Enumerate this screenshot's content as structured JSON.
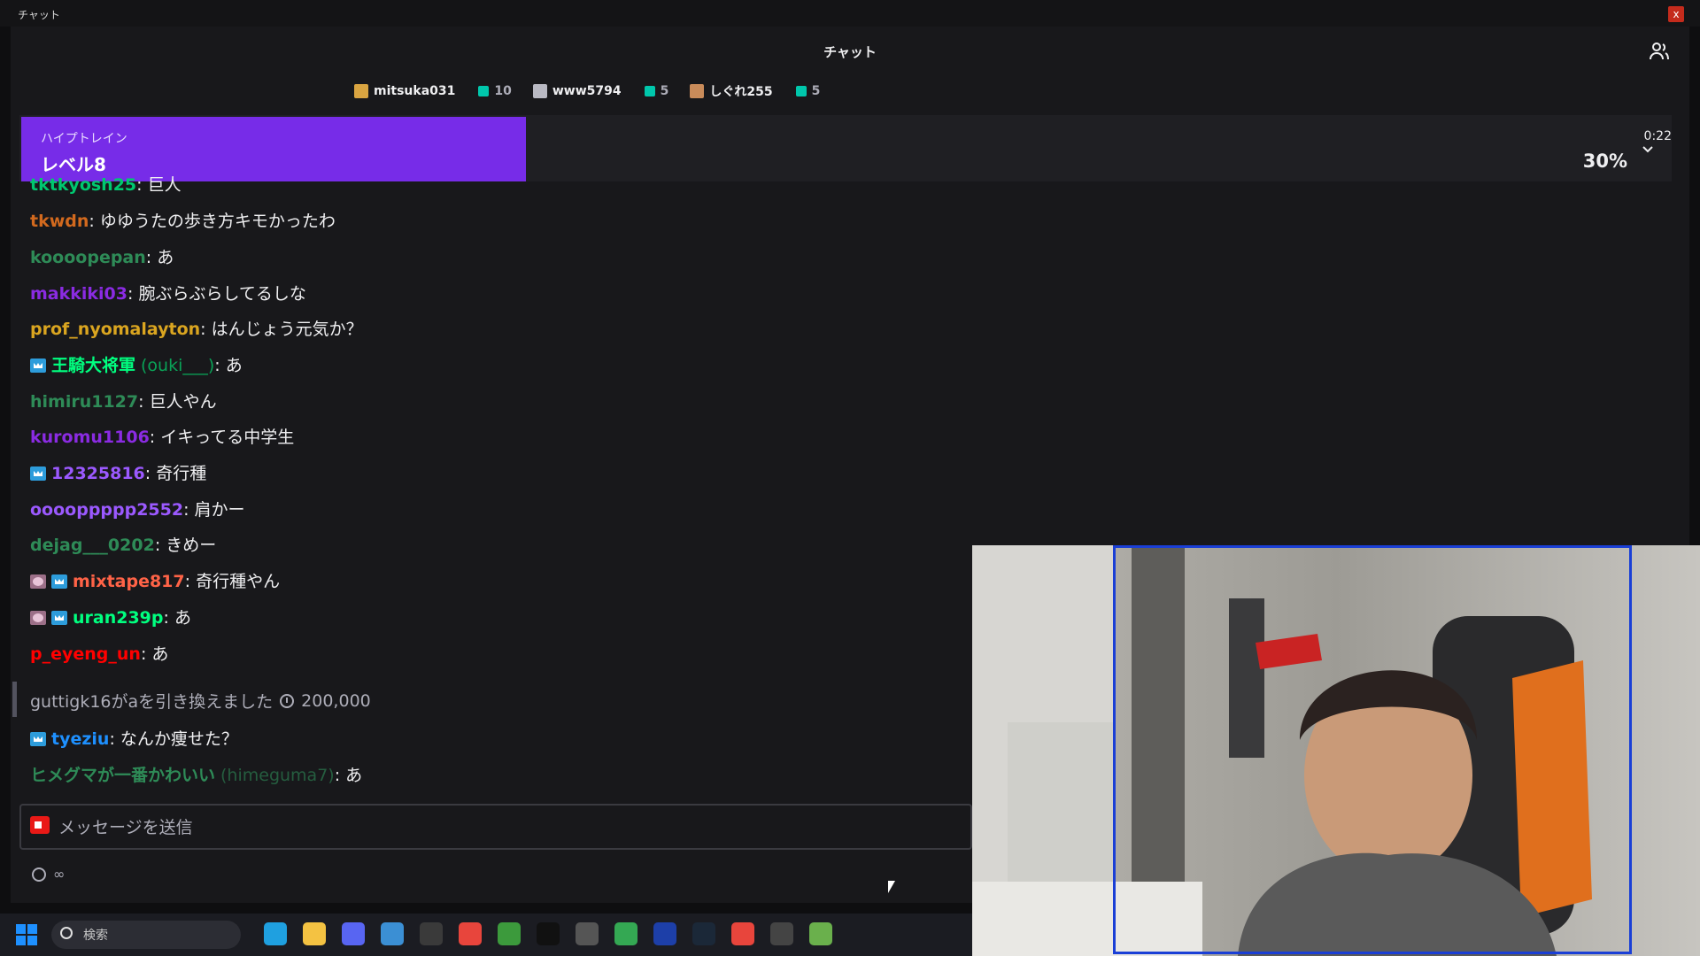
{
  "window": {
    "title": "チャット",
    "close_label": "x"
  },
  "header": {
    "title": "チャット"
  },
  "leaderboard": [
    {
      "name": "mitsuka031",
      "count": "10",
      "gift_color": "#d9a441"
    },
    {
      "name": "www5794",
      "count": "5",
      "gift_color": "#b9b9c3"
    },
    {
      "name": "しぐれ255",
      "count": "5",
      "gift_color": "#c98b5a"
    }
  ],
  "hype_train": {
    "label": "ハイプトレイン",
    "level": "レベル8",
    "time": "0:22",
    "percent": "30%",
    "progress_percent": 30
  },
  "messages": [
    {
      "user": "tktkyosh25",
      "text": ": 巨人",
      "color": "#00c870"
    },
    {
      "user": "tkwdn",
      "text": ": ゆゆうたの歩き方キモかったわ",
      "color": "#d2691e"
    },
    {
      "user": "koooopepan",
      "text": ": あ",
      "color": "#2e8b57"
    },
    {
      "user": "makkiki03",
      "text": ": 腕ぶらぶらしてるしな",
      "color": "#8a2be2"
    },
    {
      "user": "prof_nyomalayton",
      "text": ": はんじょう元気か？",
      "color": "#daa520"
    },
    {
      "user": "王騎大将軍",
      "sub_login": "(ouki___)",
      "text": ": あ",
      "color": "#00ff7f",
      "badges": [
        "sub"
      ]
    },
    {
      "user": "himiru1127",
      "text": ": 巨人やん",
      "color": "#2e8b57"
    },
    {
      "user": "kuromu1106",
      "text": ": イキってる中学生",
      "color": "#8a2be2"
    },
    {
      "user": "12325816",
      "text": ": 奇行種",
      "color": "#9b59ff",
      "badges": [
        "sub"
      ]
    },
    {
      "user": "ooooppppp2552",
      "text": ": 肩かー",
      "color": "#9b59ff"
    },
    {
      "user": "dejag___0202",
      "text": ": きめー",
      "color": "#2e8b57"
    },
    {
      "user": "mixtape817",
      "text": ": 奇行種やん",
      "color": "#ff6347",
      "badges": [
        "art",
        "sub"
      ]
    },
    {
      "user": "uran239p",
      "text": ": あ",
      "color": "#00ff7f",
      "badges": [
        "art",
        "sub"
      ]
    },
    {
      "user": "p_eyeng_un",
      "text": ": あ",
      "color": "#ff0000"
    },
    {
      "user": "tyeziu",
      "text": ": なんか痩せた？",
      "color": "#1e90ff",
      "badges": [
        "sub"
      ]
    },
    {
      "user": "ヒメグマが一番かわいい",
      "sub_login": "(himeguma7)",
      "text": ": あ",
      "color": "#2e8b57"
    }
  ],
  "redemption": {
    "text": "guttigk16がaを引き換えました",
    "points": "200,000"
  },
  "input": {
    "placeholder": "メッセージを送信"
  },
  "points": {
    "value": "∞"
  },
  "taskbar": {
    "search_placeholder": "検索"
  }
}
